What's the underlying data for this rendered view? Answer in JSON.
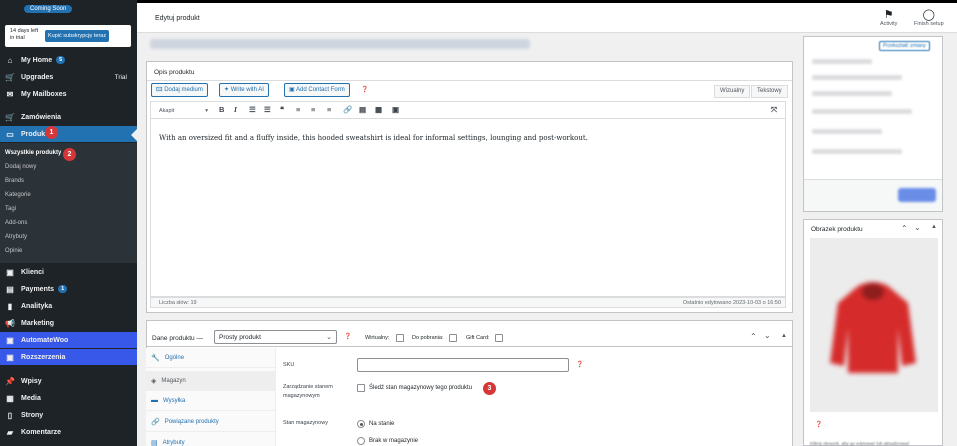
{
  "sidebar": {
    "coming_soon": "Coming Soon",
    "trial_text": "14 days left in trial",
    "trial_button": "Kupić subskrypcję teraz",
    "items": [
      {
        "label": "My Home",
        "icon": "home-icon",
        "badge": "5"
      },
      {
        "label": "Upgrades",
        "icon": "cart-icon",
        "right": "Trial"
      },
      {
        "label": "My Mailboxes",
        "icon": "mail-icon"
      },
      {
        "label": "Zamówienia",
        "icon": "cart-icon"
      },
      {
        "label": "Produkty",
        "icon": "archive-icon"
      },
      {
        "label": "Klienci",
        "icon": "users-icon"
      },
      {
        "label": "Payments",
        "icon": "card-icon",
        "badge": "1"
      },
      {
        "label": "Analityka",
        "icon": "chart-icon"
      },
      {
        "label": "Marketing",
        "icon": "megaphone-icon"
      },
      {
        "label": "AutomateWoo",
        "icon": "automatewoo-icon"
      },
      {
        "label": "Rozszerzenia",
        "icon": "woo-icon"
      },
      {
        "label": "Wpisy",
        "icon": "pin-icon"
      },
      {
        "label": "Media",
        "icon": "media-icon"
      },
      {
        "label": "Strony",
        "icon": "page-icon"
      },
      {
        "label": "Komentarze",
        "icon": "comment-icon"
      }
    ],
    "submenu": [
      "Wszystkie produkty",
      "Dodaj nowy",
      "Brands",
      "Kategorie",
      "Tagi",
      "Add-ons",
      "Atrybuty",
      "Opinie"
    ],
    "steps": [
      "1",
      "2"
    ]
  },
  "header": {
    "title": "Edytuj produkt",
    "activity": "Activity",
    "finish_setup": "Finish setup"
  },
  "side": {
    "publish_button": "Przekształć zmiany",
    "image_box_title": "Obrazek produktu",
    "image_help": "Kliknij obrazek, aby go edytować lub aktualizować"
  },
  "description": {
    "box_title": "Opis produktu",
    "add_media": "Dodaj medium",
    "write_ai": "Write with AI",
    "add_form": "Add Contact Form",
    "tab_visual": "Wizualny",
    "tab_text": "Tekstowy",
    "format": "Akapit",
    "content": "With an oversized fit and a fluffy inside, this hooded sweatshirt is ideal for informal settings, lounging and post-workout.",
    "word_count": "Liczba słów: 19",
    "last_edited": "Ostatnio edytowano 2023-10-03 o 16:50"
  },
  "product_data": {
    "label": "Dane produktu —",
    "type": "Prosty produkt",
    "virtual": "Wirtualny:",
    "downloadable": "Do pobrania:",
    "gift_card": "Gift Card:",
    "tabs": [
      {
        "label": "Ogólne",
        "icon": "wrench-icon"
      },
      {
        "label": "Magazyn",
        "icon": "stock-icon"
      },
      {
        "label": "Wysyłka",
        "icon": "truck-icon"
      },
      {
        "label": "Powiązane produkty",
        "icon": "link-icon"
      },
      {
        "label": "Atrybuty",
        "icon": "list-icon"
      }
    ],
    "sku_label": "SKU",
    "stock_mgmt_label": "Zarządzanie stanem magazynowym",
    "stock_mgmt_checkbox": "Śledź stan magazynowy tego produktu",
    "stock_status_label": "Stan magazynowy",
    "in_stock": "Na stanie",
    "out_of_stock": "Brak w magazynie",
    "step": "3"
  }
}
